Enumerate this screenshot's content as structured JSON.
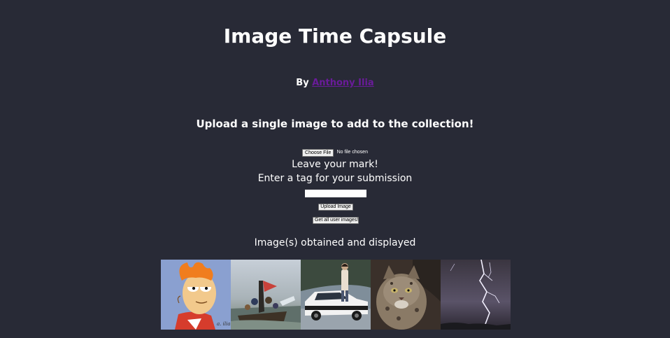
{
  "header": {
    "title": "Image Time Capsule",
    "by_prefix": "By",
    "author_name": "Anthony Ilia"
  },
  "upload": {
    "heading": "Upload a single image to add to the collection!",
    "choose_file_label": "Choose File",
    "file_status": "No file chosen",
    "mark_text": "Leave your mark!",
    "tag_label": "Enter a tag for your submission",
    "tag_value": "",
    "upload_button": "Upload Image",
    "get_all_button": "Get all user images!"
  },
  "results": {
    "heading": "Image(s) obtained and displayed",
    "images": [
      {
        "subject": "cartoon-character-squinting",
        "caption_mark": "a. ilia"
      },
      {
        "subject": "painting-boat-crossing-river"
      },
      {
        "subject": "person-with-white-car"
      },
      {
        "subject": "wild-cat"
      },
      {
        "subject": "lightning-storm"
      }
    ]
  },
  "colors": {
    "background": "#282a36",
    "text": "#ffffff",
    "link": "#6a1b9a"
  }
}
